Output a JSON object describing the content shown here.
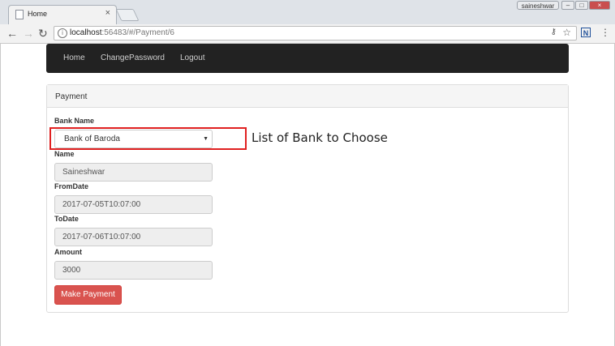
{
  "browser": {
    "tab_title": "Home",
    "tab_close": "×",
    "user_name": "saineshwar",
    "window_buttons": {
      "minimize": "–",
      "maximize": "□",
      "close": "×"
    },
    "nav": {
      "back": "←",
      "forward": "→",
      "reload": "↻"
    },
    "url_host": "localhost",
    "url_rest": ":56483/#/Payment/6",
    "extension_label": "N",
    "menu": "⋮"
  },
  "navbar": {
    "items": [
      {
        "label": "Home"
      },
      {
        "label": "ChangePassword"
      },
      {
        "label": "Logout"
      }
    ]
  },
  "panel": {
    "heading": "Payment",
    "bank": {
      "label": "Bank Name",
      "selected": "Bank of Baroda"
    },
    "name": {
      "label": "Name",
      "value": "Saineshwar"
    },
    "from_date": {
      "label": "FromDate",
      "value": "2017-07-05T10:07:00"
    },
    "to_date": {
      "label": "ToDate",
      "value": "2017-07-06T10:07:00"
    },
    "amount": {
      "label": "Amount",
      "value": "3000"
    },
    "submit_label": "Make Payment"
  },
  "annotation": "List of Bank to Choose",
  "colors": {
    "navbar_bg": "#222222",
    "button_danger": "#d9534f",
    "highlight": "#e02020"
  }
}
